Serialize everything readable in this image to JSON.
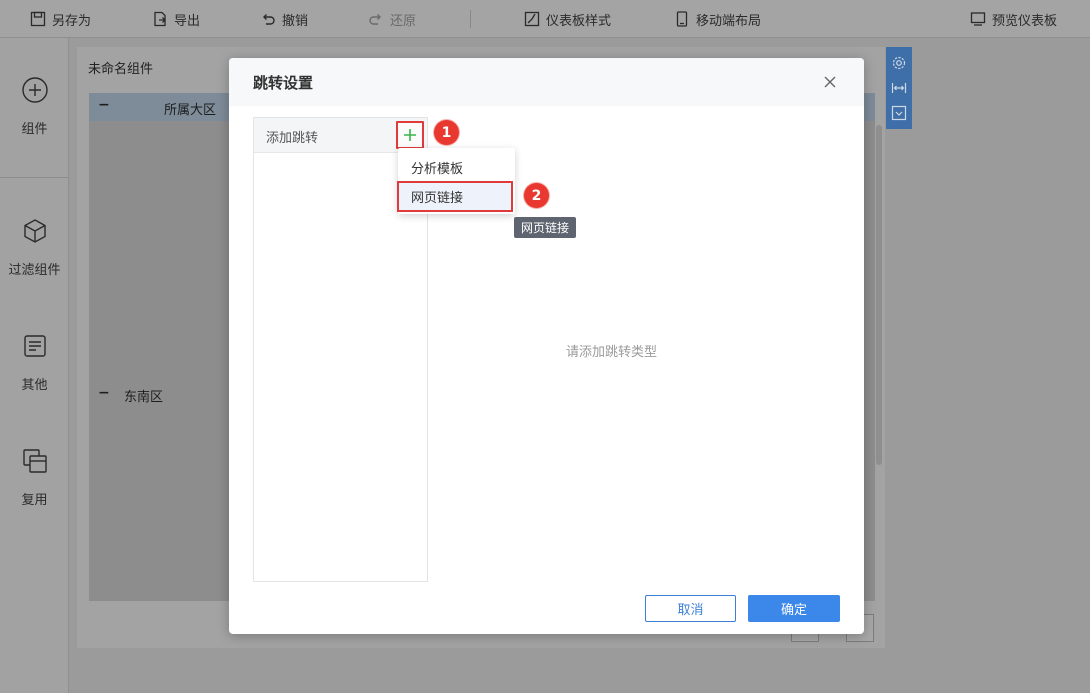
{
  "toolbar": {
    "save_as": "另存为",
    "export": "导出",
    "undo": "撤销",
    "redo": "还原",
    "dashboard_style": "仪表板样式",
    "mobile_layout": "移动端布局",
    "preview": "预览仪表板"
  },
  "sidebar": {
    "items": [
      {
        "label": "组件",
        "icon": "plus-circle-icon"
      },
      {
        "label": "过滤组件",
        "icon": "cube-icon"
      },
      {
        "label": "其他",
        "icon": "note-icon"
      },
      {
        "label": "复用",
        "icon": "copy-icon"
      }
    ]
  },
  "canvas": {
    "widget_title": "未命名组件",
    "table_header": "所属大区",
    "group_row": "东南区",
    "minus_symbol": "−"
  },
  "modal": {
    "title": "跳转设置",
    "left_panel_label": "添加跳转",
    "empty_hint": "请添加跳转类型",
    "cancel_label": "取消",
    "ok_label": "确定"
  },
  "dropdown": {
    "items": [
      "分析模板",
      "网页链接"
    ]
  },
  "tooltip": "网页链接",
  "badges": [
    "1",
    "2"
  ],
  "colors": {
    "accent": "#3b87ea",
    "highlight_red": "#e03a3a",
    "badge_red": "#e8382f",
    "add_green": "#3ab54a"
  }
}
